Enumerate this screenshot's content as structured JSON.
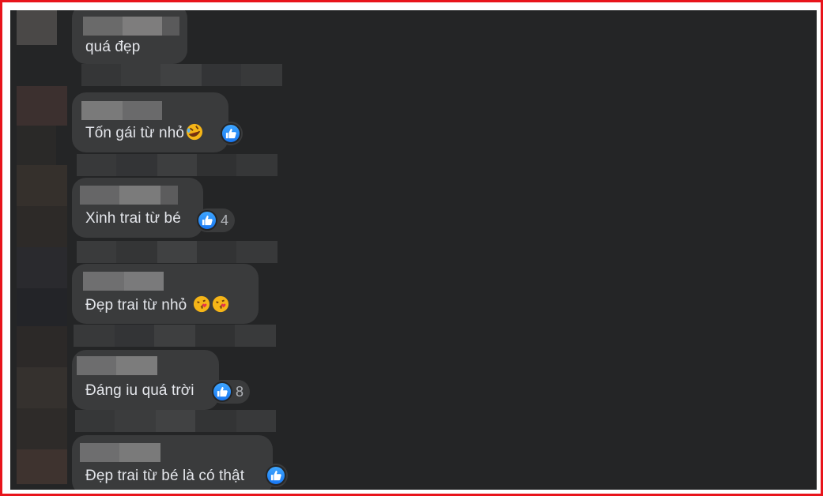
{
  "comments": [
    {
      "text": "quá đẹp",
      "likes": null
    },
    {
      "text": "Tốn gái từ nhỏ",
      "emoji": "rolling-laugh-emoji",
      "likes": ""
    },
    {
      "text": "Xinh trai từ bé",
      "likes": "4"
    },
    {
      "text": "Đẹp trai từ nhỏ",
      "emoji": "kissing-heart-emoji",
      "likes": null
    },
    {
      "text": "Đáng iu quá trời",
      "likes": "8"
    },
    {
      "text": "Đẹp trai từ bé là có thật",
      "likes": ""
    }
  ],
  "icons": {
    "like": "thumbs-up-icon"
  },
  "colors": {
    "frame": "#e8141b",
    "background": "#242526",
    "bubble": "#3a3b3c",
    "text": "#e4e6eb",
    "like": "#1877f2"
  }
}
